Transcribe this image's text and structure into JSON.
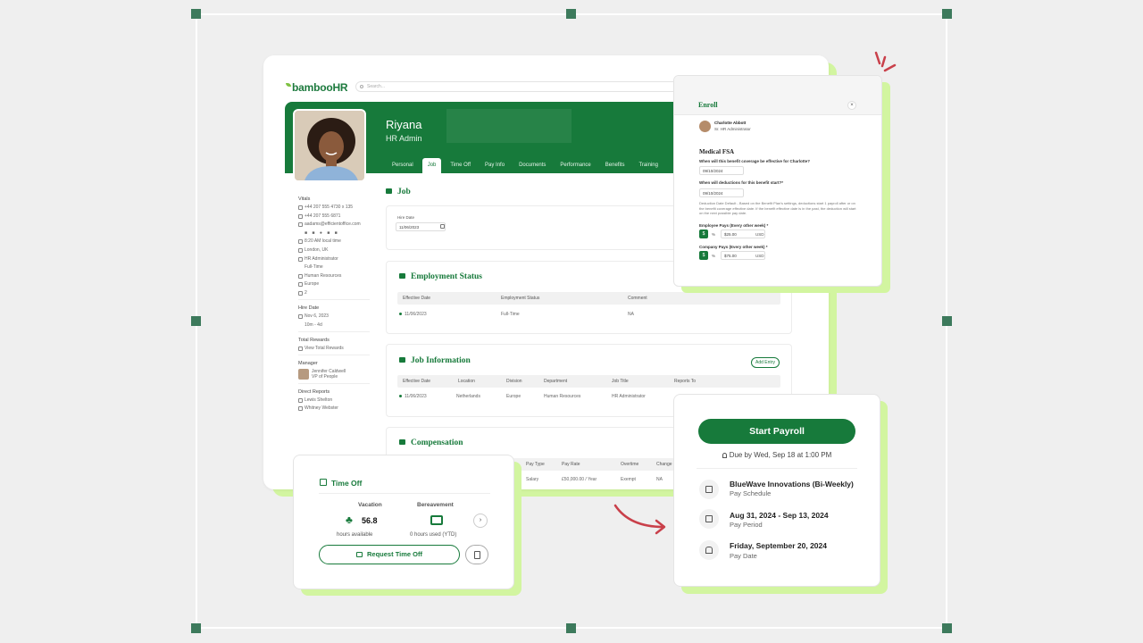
{
  "app": {
    "logo": "bambooHR",
    "search_placeholder": "Search...",
    "profile": {
      "name": "Riyana",
      "role": "HR Admin"
    },
    "tabs": [
      "Personal",
      "Job",
      "Time Off",
      "Pay Info",
      "Documents",
      "Performance",
      "Benefits",
      "Training"
    ],
    "active_tab": "Job",
    "sidebar": {
      "vitals_label": "Vitals",
      "vitals": [
        "+44 207 555 4730 x 135",
        "+44 207 555 6871",
        "aadams@efficientoffice.com",
        "8:20 AM local time",
        "London, UK",
        "HR Administrator",
        "Full-Time",
        "Human Resources",
        "Europe",
        "2"
      ],
      "hire_date_label": "Hire Date",
      "hire_date": "Nov 6, 2023",
      "hire_duration": "10m - 4d",
      "total_rewards_label": "Total Rewards",
      "view_total_rewards": "View Total Rewards",
      "manager_label": "Manager",
      "manager_name": "Jennifer Caldwell",
      "manager_role": "VP of People",
      "direct_reports_label": "Direct Reports",
      "direct_reports": [
        "Lewis Shelton",
        "Whitney Webster"
      ]
    },
    "job": {
      "title": "Job",
      "hire_date_label": "Hire Date",
      "hire_date_value": "11/06/2023"
    },
    "employment_status": {
      "title": "Employment Status",
      "columns": [
        "Effective Date",
        "Employment Status",
        "Comment"
      ],
      "row": [
        "11/06/2023",
        "Full-Time",
        "NA"
      ]
    },
    "job_information": {
      "title": "Job Information",
      "add_entry": "Add Entry",
      "columns": [
        "Effective Date",
        "Location",
        "Division",
        "Department",
        "Job Title",
        "Reports To"
      ],
      "row": [
        "11/06/2023",
        "Netherlands",
        "Europe",
        "Human Resources",
        "HR Administrator",
        ""
      ]
    },
    "compensation": {
      "title": "Compensation",
      "columns": [
        "Pay Type",
        "Pay Rate",
        "Overtime",
        "Change"
      ],
      "row": [
        "Salary",
        "£50,000.00 / Year",
        "Exempt",
        "NA"
      ]
    }
  },
  "enroll": {
    "title": "Enroll",
    "close": "×",
    "person_name": "Charlotte Abbott",
    "person_role": "Sr. HR Administrator",
    "plan": "Medical FSA",
    "q1": "When will this benefit coverage be effective for Charlotte?",
    "q1_value": "09/10/2024",
    "q2": "When will deductions for this benefit start?*",
    "q2_value": "09/10/2024",
    "note": "Deduction Date Default - Based on the Benefit Plan's settings, deductions start 1 payroll after or on the benefit coverage effective date. If the benefit effective date is in the past, the deduction will start on the next possible pay date.",
    "employee_pays_label": "Employee Pays (Every other week) *",
    "employee_pays_value": "$25.00",
    "company_pays_label": "Company Pays (Every other week) *",
    "company_pays_value": "$75.00",
    "currency": "USD",
    "dollar": "$",
    "percent": "%"
  },
  "time_off": {
    "title": "Time Off",
    "vacation_label": "Vacation",
    "vacation_value": "56.8",
    "vacation_sub": "hours available",
    "bereavement_label": "Bereavement",
    "bereavement_sub": "0 hours used (YTD)",
    "request_button": "Request Time Off",
    "chevron": "›"
  },
  "payroll": {
    "start_button": "Start Payroll",
    "due": "Due by Wed, Sep 18 at 1:00 PM",
    "items": [
      {
        "title": "BlueWave Innovations (Bi-Weekly)",
        "sub": "Pay Schedule",
        "icon": "calendar-icon"
      },
      {
        "title": "Aug 31, 2024 - Sep 13, 2024",
        "sub": "Pay Period",
        "icon": "calendar-range-icon"
      },
      {
        "title": "Friday, September 20, 2024",
        "sub": "Pay Date",
        "icon": "bank-icon"
      }
    ]
  },
  "colors": {
    "brand": "#177a3b",
    "accent": "#d2f5a0",
    "arrow": "#c9404a"
  }
}
